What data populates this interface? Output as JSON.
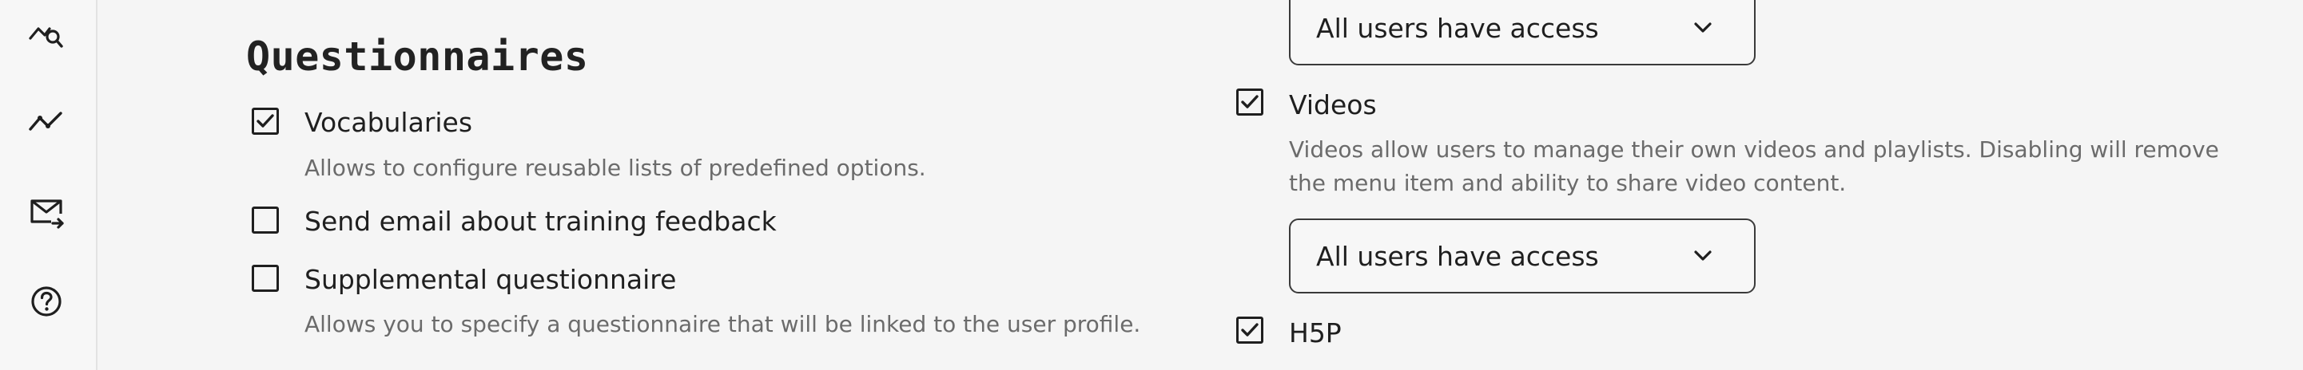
{
  "sidebar": {
    "items": [
      {
        "icon": "analytics-search-icon"
      },
      {
        "icon": "trend-line-icon"
      },
      {
        "icon": "mail-send-icon"
      },
      {
        "icon": "help-circle-icon"
      }
    ]
  },
  "section": {
    "title": "Questionnaires"
  },
  "left_options": [
    {
      "label": "Vocabularies",
      "checked": true,
      "description": "Allows to configure reusable lists of predefined options."
    },
    {
      "label": "Send email about training feedback",
      "checked": false
    },
    {
      "label": "Supplemental questionnaire",
      "checked": false,
      "description": "Allows you to specify a questionnaire that will be linked to the user profile."
    }
  ],
  "right_column": {
    "access_select_top": {
      "value": "All users have access"
    },
    "videos": {
      "label": "Videos",
      "checked": true,
      "description_line1": "Videos allow users to manage their own videos and playlists. Disabling will remove",
      "description_line2": "the menu item and ability to share video content."
    },
    "access_select_videos": {
      "value": "All users have access"
    },
    "h5p": {
      "label": "H5P",
      "checked": true
    }
  },
  "colors": {
    "background": "#f5f5f5",
    "text": "#1f1f1f",
    "muted_text": "#6b6b6b",
    "border": "#3a3a3a"
  }
}
